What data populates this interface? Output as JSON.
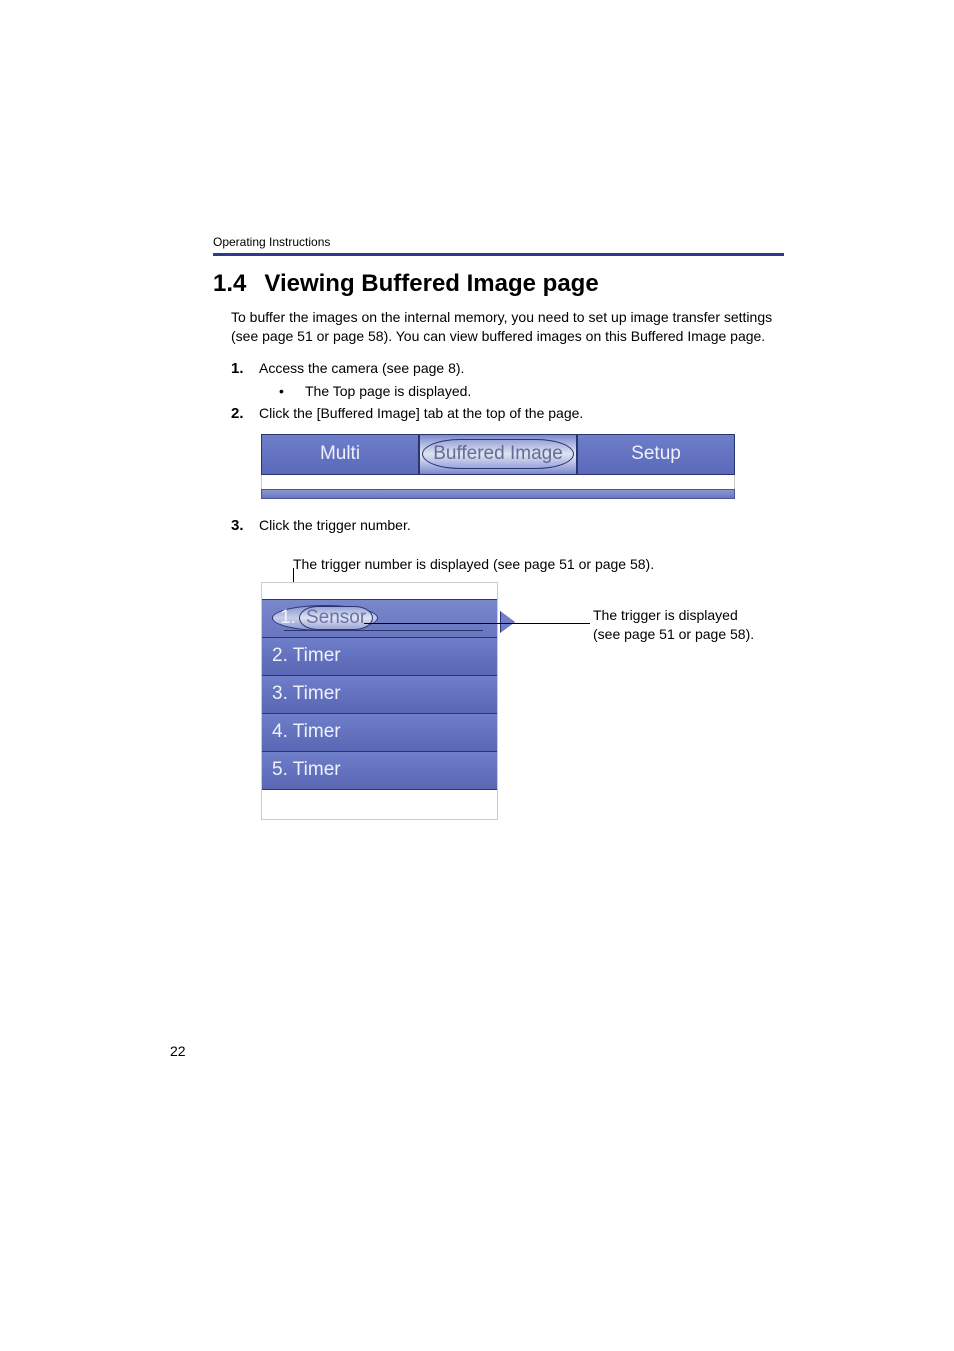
{
  "header_label": "Operating Instructions",
  "heading_number": "1.4",
  "heading_title": "Viewing Buffered Image page",
  "intro": "To buffer the images on the internal memory, you need to set up image transfer settings (see page 51 or page 58). You can view buffered images on this Buffered Image page.",
  "steps": {
    "s1": {
      "num": "1.",
      "text": "Access the camera (see page 8)."
    },
    "s1_sub": "The Top page is displayed.",
    "s2": {
      "num": "2.",
      "text": "Click the [Buffered Image] tab at the top of the page."
    },
    "s3": {
      "num": "3.",
      "text": "Click the trigger number."
    }
  },
  "tabs": {
    "left": "Multi",
    "center": "Buffered Image",
    "right": "Setup"
  },
  "secondary_text": "The trigger number is displayed (see page 51 or page 58).",
  "triggers": {
    "t1": {
      "num": "1.",
      "label": "Sensor"
    },
    "t2": "2. Timer",
    "t3": "3. Timer",
    "t4": "4. Timer",
    "t5": "5. Timer"
  },
  "callout": {
    "line1": "The trigger is displayed",
    "line2": "(see page 51 or page 58)."
  },
  "page_number": "22"
}
